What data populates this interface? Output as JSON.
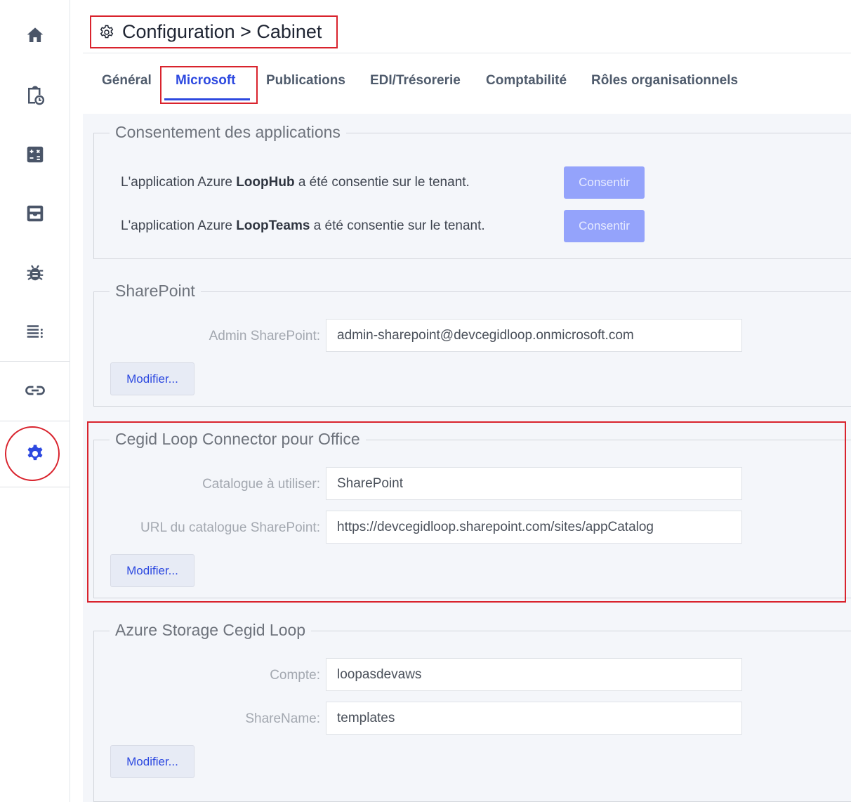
{
  "sidebar": {
    "items": [
      {
        "icon": "home-icon"
      },
      {
        "icon": "clipboard-clock-icon"
      },
      {
        "icon": "calculator-icon"
      },
      {
        "icon": "inbox-tray-icon"
      },
      {
        "icon": "bug-icon"
      },
      {
        "icon": "list-icon"
      },
      {
        "icon": "link-icon"
      },
      {
        "icon": "gear-icon"
      }
    ],
    "active_color": "#2d49e0",
    "icon_color": "#4a5568"
  },
  "header": {
    "icon": "gear-outline-icon",
    "title": "Configuration > Cabinet"
  },
  "tabs": [
    {
      "label": "Général"
    },
    {
      "label": "Microsoft",
      "active": true
    },
    {
      "label": "Publications"
    },
    {
      "label": "EDI/Trésorerie"
    },
    {
      "label": "Comptabilité"
    },
    {
      "label": "Rôles organisationnels"
    }
  ],
  "consent": {
    "legend": "Consentement des applications",
    "rows": [
      {
        "prefix": "L'application Azure ",
        "app": "LoopHub",
        "suffix": " a été consentie sur le tenant.",
        "button": "Consentir"
      },
      {
        "prefix": "L'application Azure ",
        "app": "LoopTeams",
        "suffix": " a été consentie sur le tenant.",
        "button": "Consentir"
      }
    ]
  },
  "sharepoint": {
    "legend": "SharePoint",
    "admin_label": "Admin SharePoint:",
    "admin_value": "admin-sharepoint@devcegidloop.onmicrosoft.com",
    "modify": "Modifier..."
  },
  "connector": {
    "legend": "Cegid Loop Connector pour Office",
    "catalogue_label": "Catalogue à utiliser:",
    "catalogue_value": "SharePoint",
    "url_label": "URL du catalogue SharePoint:",
    "url_value": "https://devcegidloop.sharepoint.com/sites/appCatalog",
    "modify": "Modifier..."
  },
  "storage": {
    "legend": "Azure Storage Cegid Loop",
    "account_label": "Compte:",
    "account_value": "loopasdevaws",
    "share_label": "ShareName:",
    "share_value": "templates",
    "modify": "Modifier..."
  }
}
